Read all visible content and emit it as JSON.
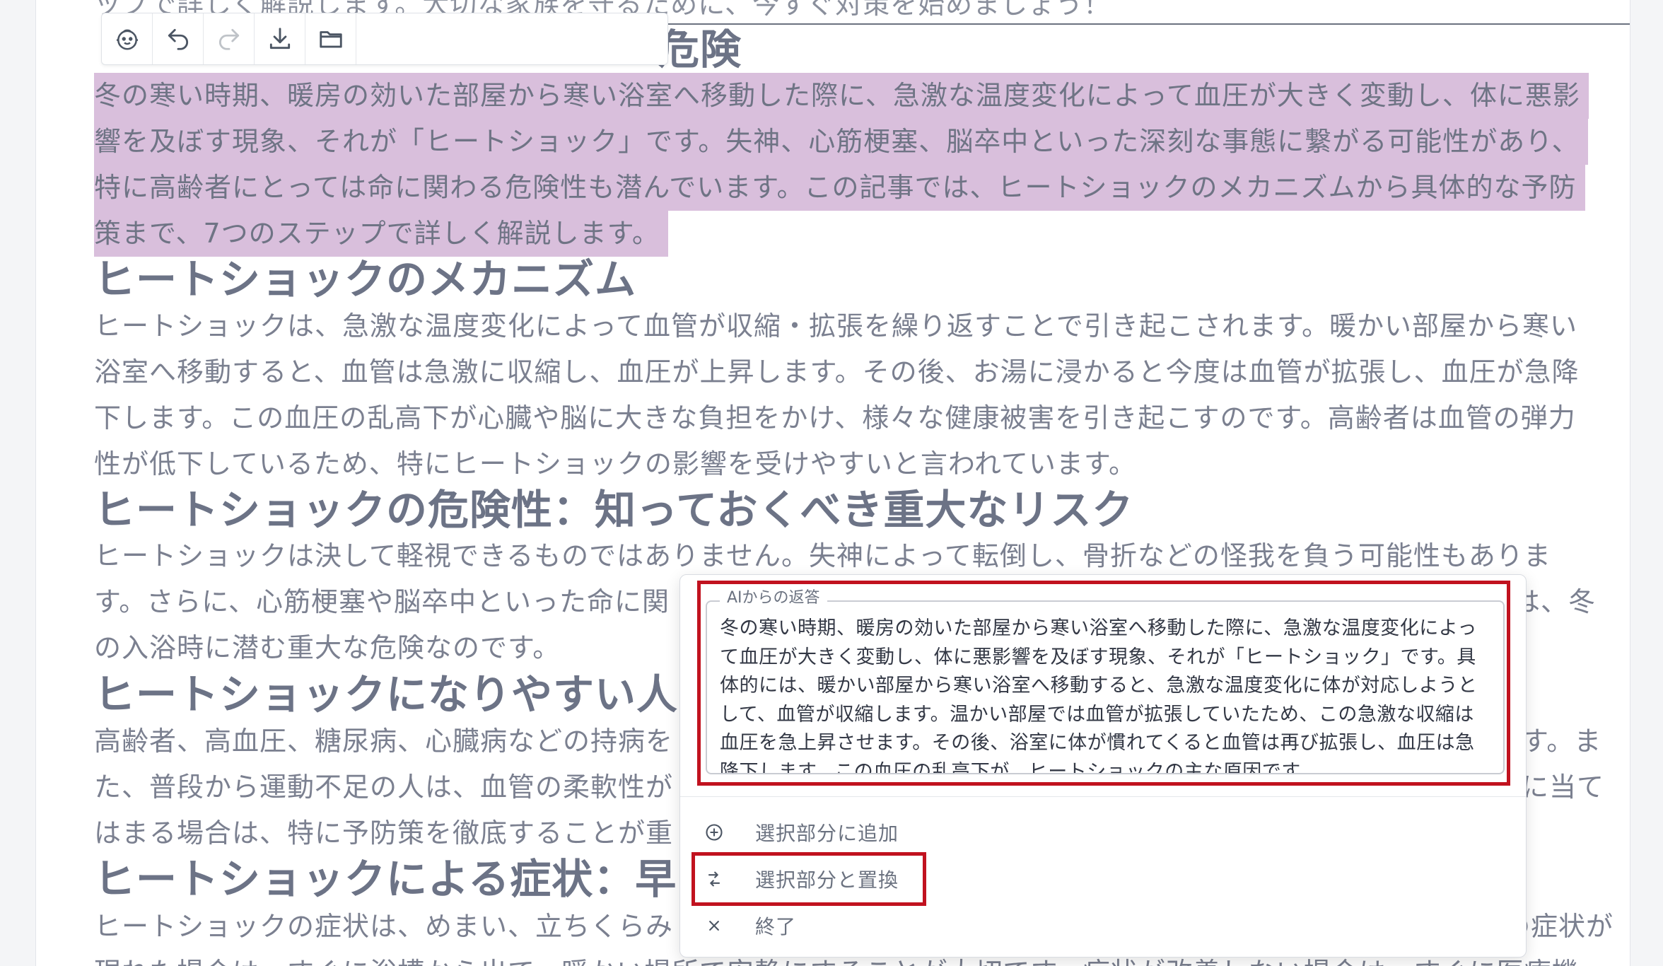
{
  "toolbar": {
    "buttons": [
      {
        "icon": "baby-face-icon"
      },
      {
        "icon": "undo-icon"
      },
      {
        "icon": "redo-icon"
      },
      {
        "icon": "download-icon"
      },
      {
        "icon": "folder-icon"
      }
    ]
  },
  "article": {
    "top_cut_line": "ップで詳しく解説します。大切な家族を守るために、今すぐ対策を始めましょう！",
    "heading_1_visible": "危険",
    "intro_lines": [
      "冬の寒い時期、暖房の効いた部屋から寒い浴室へ移動した際に、急激な温度変化によって血圧が大きく変動し、体に悪影",
      "響を及ぼす現象、それが「ヒートショック」です。失神、心筋梗塞、脳卒中といった深刻な事態に繋がる可能性があり、",
      "特に高齢者にとっては命に関わる危険性も潜んでいます。この記事では、ヒートショックのメカニズムから具体的な予防",
      "策まで、7つのステップで詳しく解説します。"
    ],
    "heading_2": "ヒートショックのメカニズム",
    "mechanism_lines": [
      "ヒートショックは、急激な温度変化によって血管が収縮・拡張を繰り返すことで引き起こされます。暖かい部屋から寒い",
      "浴室へ移動すると、血管は急激に収縮し、血圧が上昇します。その後、お湯に浸かると今度は血管が拡張し、血圧が急降",
      "下します。この血圧の乱高下が心臓や脳に大きな負担をかけ、様々な健康被害を引き起こすのです。高齢者は血管の弾力",
      "性が低下しているため、特にヒートショックの影響を受けやすいと言われています。"
    ],
    "heading_3": "ヒートショックの危険性：知っておくべき重大なリスク",
    "risk_lines": [
      "ヒートショックは決して軽視できるものではありません。失神によって転倒し、骨折などの怪我を負う可能性もありま",
      "す。さらに、心筋梗塞や脳卒中といった命に関",
      "の入浴時に潜む重大な危険なのです。"
    ],
    "risk_line_2_right": "クは、冬",
    "heading_4": "ヒートショックになりやすい人",
    "prone_lines": [
      "高齢者、高血圧、糖尿病、心臓病などの持病を",
      "た、普段から運動不足の人は、血管の柔軟性が",
      "はまる場合は、特に予防策を徹底することが重"
    ],
    "prone_lines_right": [
      "ます。ま",
      "件に当て"
    ],
    "heading_5": "ヒートショックによる症状：早",
    "symptom_line": "ヒートショックの症状は、めまい、立ちくらみ",
    "symptom_line_right": "の症状が",
    "bottom_cut_line": "現れた場合は、すぐに浴槽から出て、暖かい場所で安静にすることが大切です。症状が改善しない場合は、すぐに医療機"
  },
  "ai_popup": {
    "legend": "AIからの返答",
    "response": "冬の寒い時期、暖房の効いた部屋から寒い浴室へ移動した際に、急激な温度変化によって血圧が大きく変動し、体に悪影響を及ぼす現象、それが「ヒートショック」です。具体的には、暖かい部屋から寒い浴室へ移動すると、急激な温度変化に体が対応しようとして、血管が収縮します。温かい部屋では血管が拡張していたため、この急激な収縮は血圧を急上昇させます。その後、浴室に体が慣れてくると血管は再び拡張し、血圧は急降下します。この血圧の乱高下が、ヒートショックの主な原因です。",
    "menu": {
      "add": "選択部分に追加",
      "replace": "選択部分と置換",
      "close": "終了"
    }
  }
}
